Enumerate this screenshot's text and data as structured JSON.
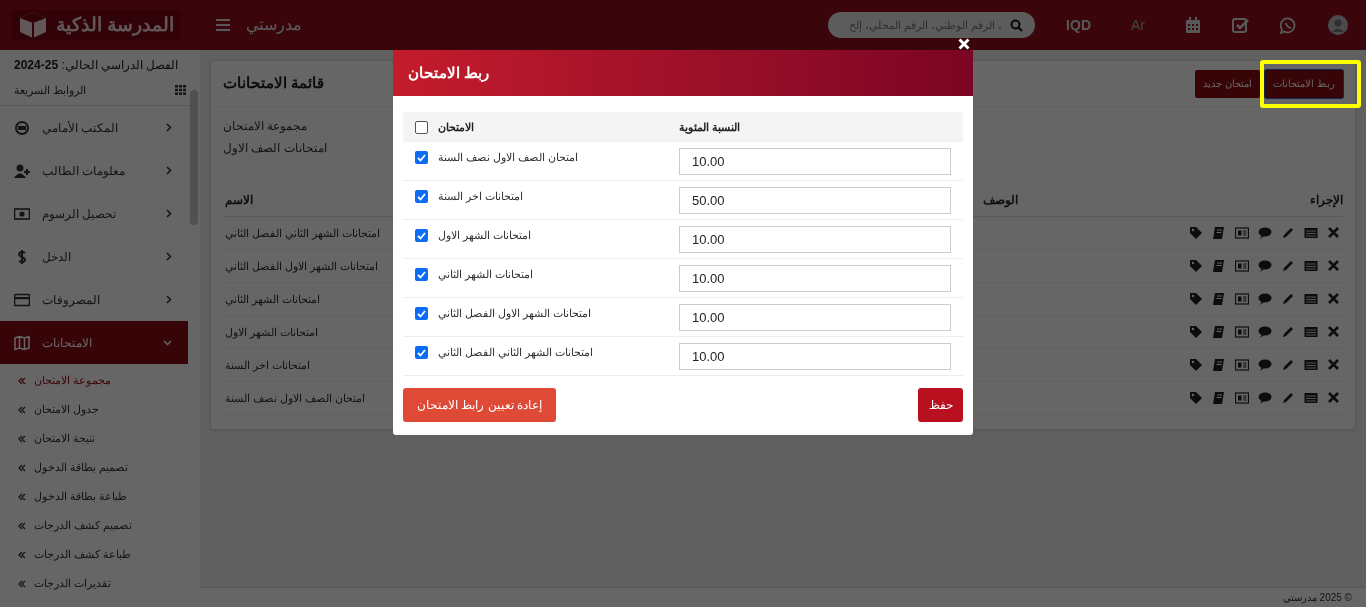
{
  "header": {
    "brand": "المدرسة الذكية",
    "app_title": "مدرستي",
    "search": {
      "placeholder": "، الرقم الوطني، الرقم المحلي، إلخ"
    },
    "currency": "IQD",
    "language": "Ar"
  },
  "sidebar": {
    "term": "الفصل الدراسي الحالي: **25-2024**",
    "quick_links": "الروابط السريعة",
    "menu": [
      {
        "label": "المكتب الأمامي",
        "expanded": false,
        "selected": false
      },
      {
        "label": "معلومات الطالب",
        "expanded": false,
        "selected": false
      },
      {
        "label": "تحصيل الرسوم",
        "expanded": false,
        "selected": false
      },
      {
        "label": "الدخل",
        "expanded": false,
        "selected": false
      },
      {
        "label": "المصروفات",
        "expanded": false,
        "selected": false
      },
      {
        "label": "الامتحانات",
        "expanded": true,
        "selected": true,
        "children": [
          {
            "label": "مجموعة الامتحان",
            "selected": true
          },
          {
            "label": "جدول الامتحان",
            "selected": false
          },
          {
            "label": "نتيجة الامتحان",
            "selected": false
          },
          {
            "label": "تصميم بطاقة الدخول",
            "selected": false
          },
          {
            "label": "طباعة بطاقة الدخول",
            "selected": false
          },
          {
            "label": "تصميم كشف الدرجات",
            "selected": false
          },
          {
            "label": "طباعة كشف الدرجات",
            "selected": false
          },
          {
            "label": "تقديرات الدرجات",
            "selected": false
          }
        ]
      }
    ]
  },
  "main": {
    "title": "قائمة الامتحانات",
    "buttons": [
      {
        "label": "ربط الامتحانات",
        "highlighted": true
      },
      {
        "label": "امتحان جديد",
        "highlighted": false
      }
    ],
    "group_label": "مجموعة الامتحان",
    "group_value": "امتحانات الصف الاول",
    "columns": [
      "الإجراء",
      "الوصف",
      "الاسم"
    ],
    "rows": [
      {
        "name": "امتحانات الشهر الثاني الفصل الثاني"
      },
      {
        "name": "امتحانات الشهر الاول الفصل الثاني"
      },
      {
        "name": "امتحانات الشهر الثاني"
      },
      {
        "name": "امتحانات الشهر الاول"
      },
      {
        "name": "امتحانات اخر السنة"
      },
      {
        "name": "امتحان الصف الاول نصف السنة"
      }
    ]
  },
  "modal": {
    "title": "ربط الامتحان",
    "columns": [
      "النسبة المئوية",
      "الامتحان"
    ],
    "select_all": {
      "checked": false
    },
    "rows": [
      {
        "exam": "امتحان الصف الاول نصف السنة",
        "checked": true,
        "percentage": "10.00"
      },
      {
        "exam": "امتحانات اخر السنة",
        "checked": true,
        "percentage": "50.00"
      },
      {
        "exam": "امتحانات الشهر الاول",
        "checked": true,
        "percentage": "10.00"
      },
      {
        "exam": "امتحانات الشهر الثاني",
        "checked": true,
        "percentage": "10.00"
      },
      {
        "exam": "امتحانات الشهر الاول الفصل الثاني",
        "checked": true,
        "percentage": "10.00"
      },
      {
        "exam": "امتحانات الشهر الثاني الفصل الثاني",
        "checked": true,
        "percentage": "10.00"
      }
    ],
    "reset_button": "إعادة تعيين رابط الامتحان",
    "save_button": "حفظ"
  },
  "footer": "© 2025 مدرستي"
}
